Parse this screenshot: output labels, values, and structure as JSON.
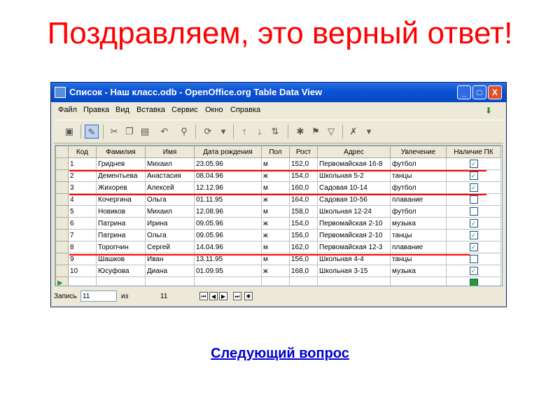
{
  "headline": "Поздравляем, это верный ответ!",
  "next_link": "Следующий вопрос",
  "window": {
    "title": "Список - Наш класс.odb - OpenOffice.org Table Data View",
    "controls": {
      "minimize": "_",
      "maximize": "□",
      "close": "X"
    }
  },
  "menu": [
    "Файл",
    "Правка",
    "Вид",
    "Вставка",
    "Сервис",
    "Окно",
    "Справка"
  ],
  "table": {
    "columns": [
      "Код",
      "Фамилия",
      "Имя",
      "Дата рождения",
      "Пол",
      "Рост",
      "Адрес",
      "Увлечение",
      "Наличие ПК"
    ],
    "rows": [
      {
        "code": "1",
        "last": "Гриднев",
        "first": "Михаил",
        "dob": "23.05.96",
        "sex": "м",
        "height": "152,0",
        "address": "Первомайская 16-8",
        "hobby": "футбол",
        "pc": true
      },
      {
        "code": "2",
        "last": "Дементьева",
        "first": "Анастасия",
        "dob": "08.04.96",
        "sex": "ж",
        "height": "154,0",
        "address": "Школьная 5-2",
        "hobby": "танцы",
        "pc": true
      },
      {
        "code": "3",
        "last": "Жихорев",
        "first": "Алексей",
        "dob": "12.12.96",
        "sex": "м",
        "height": "160,0",
        "address": "Садовая 10-14",
        "hobby": "футбол",
        "pc": true
      },
      {
        "code": "4",
        "last": "Кочергина",
        "first": "Ольга",
        "dob": "01.11.95",
        "sex": "ж",
        "height": "164,0",
        "address": "Садовая 10-56",
        "hobby": "плавание",
        "pc": false
      },
      {
        "code": "5",
        "last": "Новиков",
        "first": "Михаил",
        "dob": "12.08.96",
        "sex": "м",
        "height": "158,0",
        "address": "Школьная 12-24",
        "hobby": "футбол",
        "pc": false
      },
      {
        "code": "6",
        "last": "Патрина",
        "first": "Ирина",
        "dob": "09.05.96",
        "sex": "ж",
        "height": "154,0",
        "address": "Первомайская 2-10",
        "hobby": "музыка",
        "pc": true
      },
      {
        "code": "7",
        "last": "Патрина",
        "first": "Ольга",
        "dob": "09.05.96",
        "sex": "ж",
        "height": "156,0",
        "address": "Первомайская 2-10",
        "hobby": "танцы",
        "pc": true
      },
      {
        "code": "8",
        "last": "Торопчин",
        "first": "Сергей",
        "dob": "14.04.96",
        "sex": "м",
        "height": "162,0",
        "address": "Первомайская 12-3",
        "hobby": "плавание",
        "pc": true
      },
      {
        "code": "9",
        "last": "Шашков",
        "first": "Иван",
        "dob": "13.11.95",
        "sex": "м",
        "height": "156,0",
        "address": "Школьная 4-4",
        "hobby": "танцы",
        "pc": false
      },
      {
        "code": "10",
        "last": "Юсуфова",
        "first": "Диана",
        "dob": "01.09.95",
        "sex": "ж",
        "height": "168,0",
        "address": "Школьная 3-15",
        "hobby": "музыка",
        "pc": true
      }
    ]
  },
  "status": {
    "record_label": "Запись",
    "record_value": "11",
    "of_label": "из",
    "total": "11"
  },
  "colors": {
    "headline": "#ff0000",
    "link": "#0000cc",
    "underline_marks": "#ff0000",
    "titlebar": "#0a54d6"
  }
}
